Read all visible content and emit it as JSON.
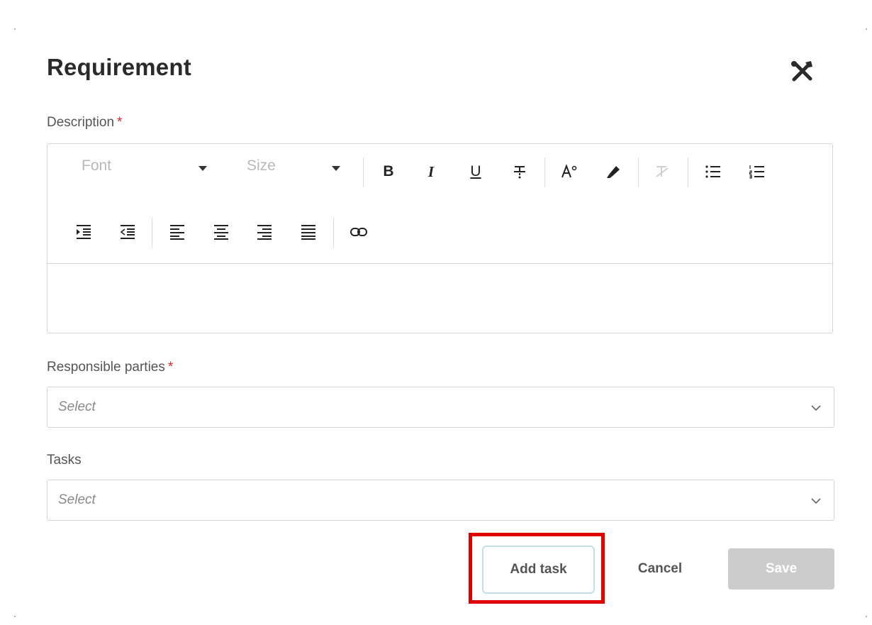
{
  "dialog": {
    "title": "Requirement"
  },
  "description": {
    "label": "Description",
    "required_mark": "*"
  },
  "toolbar": {
    "font_placeholder": "Font",
    "size_placeholder": "Size"
  },
  "responsible_parties": {
    "label": "Responsible parties",
    "required_mark": "*",
    "placeholder": "Select"
  },
  "tasks": {
    "label": "Tasks",
    "placeholder": "Select"
  },
  "actions": {
    "add_task_label": "Add task",
    "cancel_label": "Cancel",
    "save_label": "Save"
  },
  "colors": {
    "required": "#d9262c",
    "highlight": "#e00000",
    "save_disabled_bg": "#cccccc",
    "add_task_border": "#bfe0ea"
  }
}
